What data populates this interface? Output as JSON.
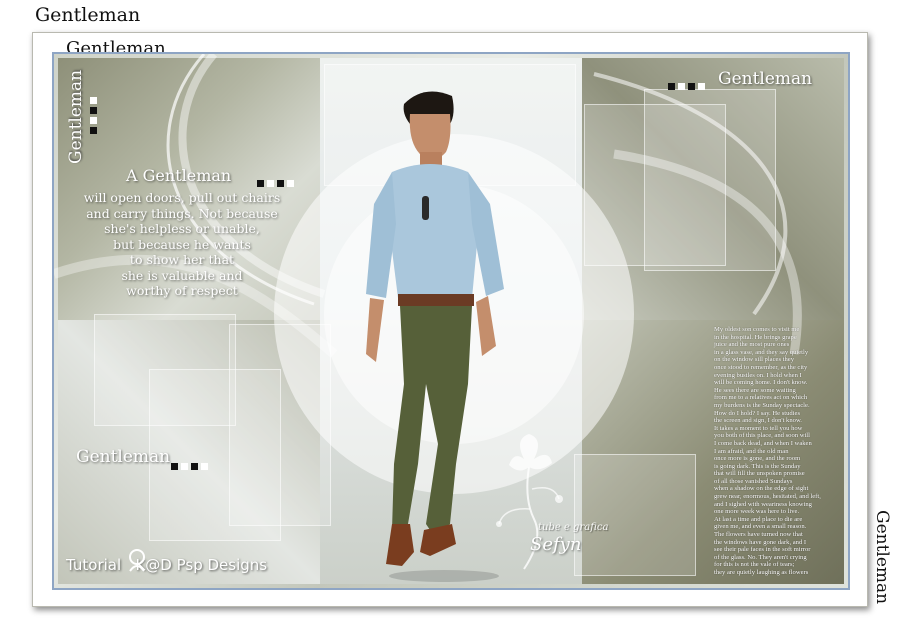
{
  "corner_titles": {
    "top_left": "Gentleman",
    "top_left_inner": "Gentleman",
    "right_vertical": "Gentleman"
  },
  "artwork": {
    "left_vertical_title": "Gentleman",
    "top_right_title": "Gentleman",
    "bottom_left_title": "Gentleman",
    "quote_heading": "A Gentleman",
    "quote_lines": [
      "will open doors, pull out chairs",
      "and carry things. Not because",
      "she's helpless or unable,",
      "but because he wants",
      "to show her that",
      "she is valuable and",
      "worthy of respect"
    ],
    "tube_credit_line1": "tube e grafica",
    "tube_credit_line2": "Sefyn",
    "tutorial_credit": "Tutorial   K@D Psp Designs",
    "small_poem_lines": [
      "My oldest son comes to visit me",
      "in the hospital. He brings grape",
      "juice and the most pure ones",
      "in a glass vase, and they say quietly",
      "on the window sill places they",
      "once stood to remember, as the city",
      "evening bustles on. I hold when I",
      "will be coming home. I don't know.",
      "He sees there are some waiting",
      "from me to a relatives act on which",
      "my burdens is the Sunday spectacle.",
      "How do I hold? I say. He studies",
      "the screen and sign, I don't know.",
      "It takes a moment to tell you how",
      "you both of this place, and soon will",
      "I come back dead, and when I waken",
      "I am afraid, and the old man",
      "once more is gone, and the room",
      "is going dark. This is the Sunday",
      "that will fill the unspoken promise",
      "of all those vanished Sundays",
      "when a shadow on the edge of sight",
      "grew near, enormous, hesitated, and left,",
      "and I sighed with weariness knowing",
      "one more week was here to live.",
      "At last a time and place to die are",
      "given me, and even a small reason.",
      "The flowers have turned now that",
      "the windows have gone dark, and I",
      "see their pale faces in the soft mirror",
      "of the glass. No. They aren't crying",
      "for this is not the vale of tears;",
      "they are quietly laughing as flowers"
    ],
    "accent_colors": {
      "frame_border": "#8ea5c4",
      "olive": "#7c7d62",
      "shirt": "#a9c6dc",
      "trousers": "#4f5a38"
    }
  }
}
